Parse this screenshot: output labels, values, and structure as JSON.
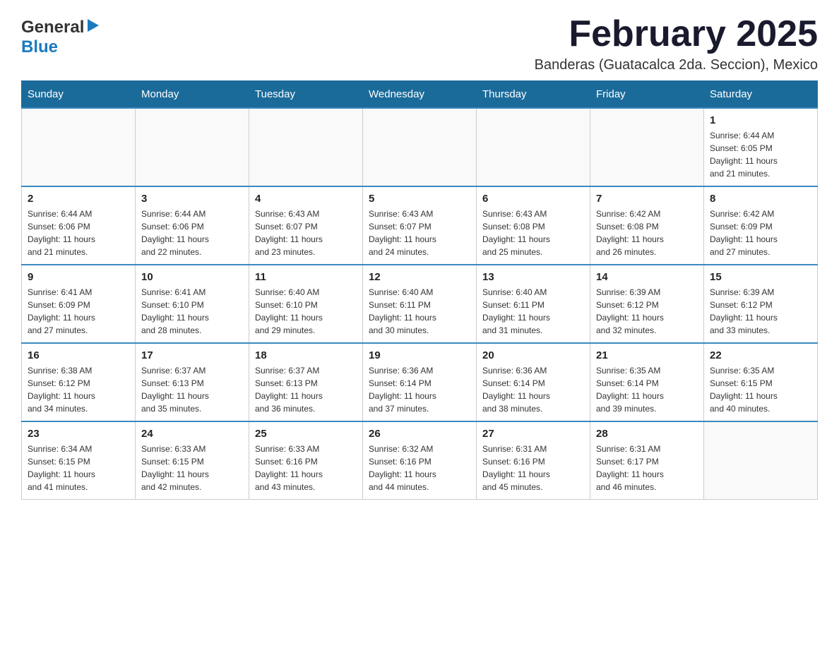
{
  "logo": {
    "general": "General",
    "blue": "Blue",
    "arrow": "▶"
  },
  "title": "February 2025",
  "location": "Banderas (Guatacalca 2da. Seccion), Mexico",
  "days_of_week": [
    "Sunday",
    "Monday",
    "Tuesday",
    "Wednesday",
    "Thursday",
    "Friday",
    "Saturday"
  ],
  "weeks": [
    [
      {
        "day": "",
        "info": ""
      },
      {
        "day": "",
        "info": ""
      },
      {
        "day": "",
        "info": ""
      },
      {
        "day": "",
        "info": ""
      },
      {
        "day": "",
        "info": ""
      },
      {
        "day": "",
        "info": ""
      },
      {
        "day": "1",
        "info": "Sunrise: 6:44 AM\nSunset: 6:05 PM\nDaylight: 11 hours\nand 21 minutes."
      }
    ],
    [
      {
        "day": "2",
        "info": "Sunrise: 6:44 AM\nSunset: 6:06 PM\nDaylight: 11 hours\nand 21 minutes."
      },
      {
        "day": "3",
        "info": "Sunrise: 6:44 AM\nSunset: 6:06 PM\nDaylight: 11 hours\nand 22 minutes."
      },
      {
        "day": "4",
        "info": "Sunrise: 6:43 AM\nSunset: 6:07 PM\nDaylight: 11 hours\nand 23 minutes."
      },
      {
        "day": "5",
        "info": "Sunrise: 6:43 AM\nSunset: 6:07 PM\nDaylight: 11 hours\nand 24 minutes."
      },
      {
        "day": "6",
        "info": "Sunrise: 6:43 AM\nSunset: 6:08 PM\nDaylight: 11 hours\nand 25 minutes."
      },
      {
        "day": "7",
        "info": "Sunrise: 6:42 AM\nSunset: 6:08 PM\nDaylight: 11 hours\nand 26 minutes."
      },
      {
        "day": "8",
        "info": "Sunrise: 6:42 AM\nSunset: 6:09 PM\nDaylight: 11 hours\nand 27 minutes."
      }
    ],
    [
      {
        "day": "9",
        "info": "Sunrise: 6:41 AM\nSunset: 6:09 PM\nDaylight: 11 hours\nand 27 minutes."
      },
      {
        "day": "10",
        "info": "Sunrise: 6:41 AM\nSunset: 6:10 PM\nDaylight: 11 hours\nand 28 minutes."
      },
      {
        "day": "11",
        "info": "Sunrise: 6:40 AM\nSunset: 6:10 PM\nDaylight: 11 hours\nand 29 minutes."
      },
      {
        "day": "12",
        "info": "Sunrise: 6:40 AM\nSunset: 6:11 PM\nDaylight: 11 hours\nand 30 minutes."
      },
      {
        "day": "13",
        "info": "Sunrise: 6:40 AM\nSunset: 6:11 PM\nDaylight: 11 hours\nand 31 minutes."
      },
      {
        "day": "14",
        "info": "Sunrise: 6:39 AM\nSunset: 6:12 PM\nDaylight: 11 hours\nand 32 minutes."
      },
      {
        "day": "15",
        "info": "Sunrise: 6:39 AM\nSunset: 6:12 PM\nDaylight: 11 hours\nand 33 minutes."
      }
    ],
    [
      {
        "day": "16",
        "info": "Sunrise: 6:38 AM\nSunset: 6:12 PM\nDaylight: 11 hours\nand 34 minutes."
      },
      {
        "day": "17",
        "info": "Sunrise: 6:37 AM\nSunset: 6:13 PM\nDaylight: 11 hours\nand 35 minutes."
      },
      {
        "day": "18",
        "info": "Sunrise: 6:37 AM\nSunset: 6:13 PM\nDaylight: 11 hours\nand 36 minutes."
      },
      {
        "day": "19",
        "info": "Sunrise: 6:36 AM\nSunset: 6:14 PM\nDaylight: 11 hours\nand 37 minutes."
      },
      {
        "day": "20",
        "info": "Sunrise: 6:36 AM\nSunset: 6:14 PM\nDaylight: 11 hours\nand 38 minutes."
      },
      {
        "day": "21",
        "info": "Sunrise: 6:35 AM\nSunset: 6:14 PM\nDaylight: 11 hours\nand 39 minutes."
      },
      {
        "day": "22",
        "info": "Sunrise: 6:35 AM\nSunset: 6:15 PM\nDaylight: 11 hours\nand 40 minutes."
      }
    ],
    [
      {
        "day": "23",
        "info": "Sunrise: 6:34 AM\nSunset: 6:15 PM\nDaylight: 11 hours\nand 41 minutes."
      },
      {
        "day": "24",
        "info": "Sunrise: 6:33 AM\nSunset: 6:15 PM\nDaylight: 11 hours\nand 42 minutes."
      },
      {
        "day": "25",
        "info": "Sunrise: 6:33 AM\nSunset: 6:16 PM\nDaylight: 11 hours\nand 43 minutes."
      },
      {
        "day": "26",
        "info": "Sunrise: 6:32 AM\nSunset: 6:16 PM\nDaylight: 11 hours\nand 44 minutes."
      },
      {
        "day": "27",
        "info": "Sunrise: 6:31 AM\nSunset: 6:16 PM\nDaylight: 11 hours\nand 45 minutes."
      },
      {
        "day": "28",
        "info": "Sunrise: 6:31 AM\nSunset: 6:17 PM\nDaylight: 11 hours\nand 46 minutes."
      },
      {
        "day": "",
        "info": ""
      }
    ]
  ]
}
